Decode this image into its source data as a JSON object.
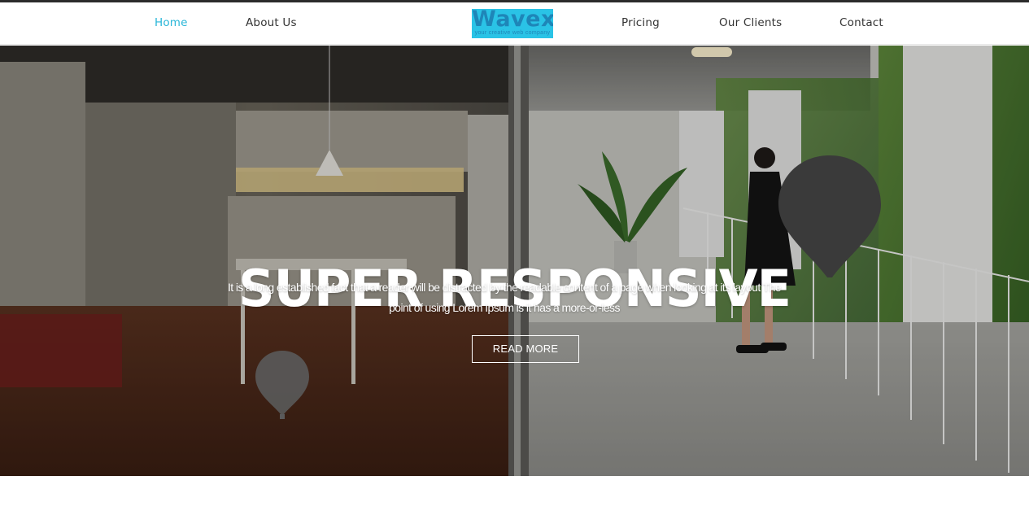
{
  "brand": {
    "logo_text": "Wavex.",
    "logo_tagline": "your creative web company",
    "logo_color": "#2ac3e6"
  },
  "nav": {
    "items": [
      {
        "label": "Home",
        "active": true
      },
      {
        "label": "About  Us",
        "active": false
      },
      {
        "label": "Pricing",
        "active": false
      },
      {
        "label": "Our  Clients",
        "active": false
      },
      {
        "label": "Contact",
        "active": false
      }
    ],
    "active_color": "#29b6d8"
  },
  "hero": {
    "title": "SUPER RESPONSIVE",
    "description": "It is a long established fact that a reader will be distracted by the readable content of a page when looking at its layout The point of using Lorem Ipsum is it has a more-or-less",
    "button_label": "READ MORE",
    "background_image": "interior-kitchen-and-balcony-photo"
  }
}
